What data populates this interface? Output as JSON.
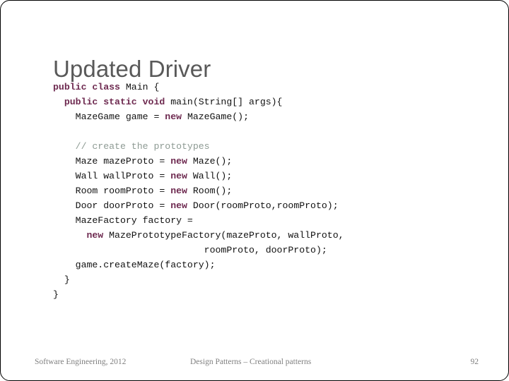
{
  "slide": {
    "title": "Updated Driver",
    "page_number": "92",
    "border_color": "#000000",
    "background_color": "#ffffff"
  },
  "theme": {
    "title_color": "#595959",
    "keyword_color": "#6E2A50",
    "comment_color": "#8E9B94",
    "code_color": "#111111",
    "footer_color": "#7F7F7F"
  },
  "code": {
    "language": "java",
    "lines": [
      [
        {
          "t": "public class",
          "k": "kw"
        },
        {
          "t": " Main {",
          "k": "plain"
        }
      ],
      [
        {
          "t": "  ",
          "k": "plain"
        },
        {
          "t": "public static void",
          "k": "kw"
        },
        {
          "t": " main(String[] args){",
          "k": "plain"
        }
      ],
      [
        {
          "t": "    MazeGame game = ",
          "k": "plain"
        },
        {
          "t": "new",
          "k": "kw"
        },
        {
          "t": " MazeGame();",
          "k": "plain"
        }
      ],
      [
        {
          "t": "",
          "k": "plain"
        }
      ],
      [
        {
          "t": "    ",
          "k": "plain"
        },
        {
          "t": "// create the prototypes",
          "k": "cmt"
        }
      ],
      [
        {
          "t": "    Maze mazeProto = ",
          "k": "plain"
        },
        {
          "t": "new",
          "k": "kw"
        },
        {
          "t": " Maze();",
          "k": "plain"
        }
      ],
      [
        {
          "t": "    Wall wallProto = ",
          "k": "plain"
        },
        {
          "t": "new",
          "k": "kw"
        },
        {
          "t": " Wall();",
          "k": "plain"
        }
      ],
      [
        {
          "t": "    Room roomProto = ",
          "k": "plain"
        },
        {
          "t": "new",
          "k": "kw"
        },
        {
          "t": " Room();",
          "k": "plain"
        }
      ],
      [
        {
          "t": "    Door doorProto = ",
          "k": "plain"
        },
        {
          "t": "new",
          "k": "kw"
        },
        {
          "t": " Door(roomProto,roomProto);",
          "k": "plain"
        }
      ],
      [
        {
          "t": "    MazeFactory factory =",
          "k": "plain"
        }
      ],
      [
        {
          "t": "      ",
          "k": "plain"
        },
        {
          "t": "new",
          "k": "kw"
        },
        {
          "t": " MazePrototypeFactory(mazeProto, wallProto,",
          "k": "plain"
        }
      ],
      [
        {
          "t": "                           roomProto, doorProto);",
          "k": "plain"
        }
      ],
      [
        {
          "t": "    game.createMaze(factory);",
          "k": "plain"
        }
      ],
      [
        {
          "t": "  }",
          "k": "plain"
        }
      ],
      [
        {
          "t": "}",
          "k": "plain"
        }
      ]
    ]
  },
  "footer": {
    "left": "Software Engineering, 2012",
    "center": "Design Patterns – Creational patterns",
    "page": "92"
  }
}
